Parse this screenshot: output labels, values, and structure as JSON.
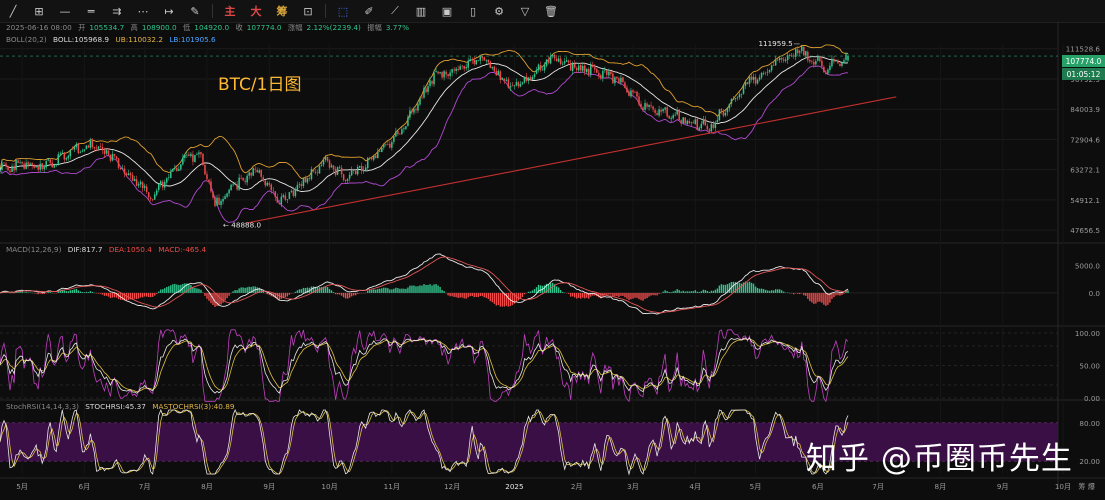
{
  "toolbar": {
    "icons": [
      "pencil-icon",
      "grid-icon",
      "horizontal-line-icon",
      "double-line-icon",
      "channel-icon",
      "dots-icon"
    ],
    "chinese_buttons": [
      "主",
      "大",
      "筹"
    ],
    "icons_right": [
      "select-icon",
      "pen-icon",
      "ruler-icon",
      "bars-icon",
      "image-icon",
      "page-icon",
      "settings-icon",
      "filter-icon",
      "trash-icon"
    ]
  },
  "info": {
    "date": "2025-06-16 08:00",
    "open_label": "开",
    "open": "105534.7",
    "high_label": "高",
    "high": "108900.0",
    "low_label": "低",
    "low": "104920.0",
    "close_label": "收",
    "close": "107774.0",
    "change_label": "涨幅",
    "change": "2.12%(2239.4)",
    "amp_label": "振幅",
    "amp": "3.77%"
  },
  "boll": {
    "label": "BOLL(20,2)",
    "boll": "BOLL:105968.9",
    "ub": "UB:110032.2",
    "lb": "LB:101905.6"
  },
  "title": "BTC/1日图",
  "price_axis": [
    "111528.6",
    "96792.9",
    "84003.9",
    "72904.6",
    "63272.1",
    "54912.1",
    "47656.5"
  ],
  "current_price": "107774.0",
  "countdown": "01:05:12",
  "peak_label": "111959.5",
  "low_label": "48888.0",
  "macd": {
    "label": "MACD(12,26,9)",
    "dif": "DIF:817.7",
    "dea": "DEA:1050.4",
    "macd": "MACD:-465.4",
    "axis": [
      "5000.0",
      "0.0"
    ]
  },
  "kdj": {
    "axis": [
      "100.00",
      "50.00",
      "0.00"
    ]
  },
  "stochrsi": {
    "label": "StochRSI(14,14,3,3)",
    "value": "STOCHRSI:45.37",
    "ma": "MASTOCHRSI(3):40.89",
    "axis": [
      "80.00",
      "20.00"
    ]
  },
  "time_axis": [
    "5月",
    "6月",
    "7月",
    "8月",
    "9月",
    "10月",
    "11月",
    "12月",
    "2025",
    "2月",
    "3月",
    "4月",
    "5月",
    "6月",
    "7月",
    "8月",
    "9月",
    "10月"
  ],
  "time_axis_right": "筹 爆",
  "watermark": "知乎 @币圈币先生",
  "colors": {
    "up": "#31c48d",
    "down": "#ef4a4a",
    "boll_mid": "#e8e8e8",
    "boll_ub": "#e0a030",
    "boll_lb": "#b04ad0",
    "trend": "#c43030"
  },
  "chart_data": {
    "type": "candlestick",
    "title": "BTC/1日图",
    "period": "daily",
    "x_range": [
      "2024-04-20",
      "2025-06-16"
    ],
    "price_ylim": [
      45500,
      113500
    ],
    "anchors": [
      {
        "date": "2024-04-20",
        "price": 64000
      },
      {
        "date": "2024-05-15",
        "price": 65000
      },
      {
        "date": "2024-05-25",
        "price": 69000
      },
      {
        "date": "2024-06-07",
        "price": 71500
      },
      {
        "date": "2024-06-25",
        "price": 61000
      },
      {
        "date": "2024-07-05",
        "price": 56000
      },
      {
        "date": "2024-07-20",
        "price": 67000
      },
      {
        "date": "2024-07-28",
        "price": 68000
      },
      {
        "date": "2024-08-05",
        "price": 54000
      },
      {
        "date": "2024-08-25",
        "price": 63500
      },
      {
        "date": "2024-09-06",
        "price": 54000
      },
      {
        "date": "2024-09-28",
        "price": 65500
      },
      {
        "date": "2024-10-10",
        "price": 60500
      },
      {
        "date": "2024-10-28",
        "price": 70000
      },
      {
        "date": "2024-11-06",
        "price": 76000
      },
      {
        "date": "2024-11-22",
        "price": 98500
      },
      {
        "date": "2024-12-17",
        "price": 106500
      },
      {
        "date": "2024-12-30",
        "price": 92500
      },
      {
        "date": "2025-01-20",
        "price": 106000
      },
      {
        "date": "2025-02-20",
        "price": 97000
      },
      {
        "date": "2025-03-05",
        "price": 86000
      },
      {
        "date": "2025-04-08",
        "price": 77000
      },
      {
        "date": "2025-04-25",
        "price": 94000
      },
      {
        "date": "2025-05-10",
        "price": 103000
      },
      {
        "date": "2025-05-22",
        "price": 111000
      },
      {
        "date": "2025-06-05",
        "price": 101500
      },
      {
        "date": "2025-06-16",
        "price": 107774
      }
    ],
    "last_candle": {
      "date": "2025-06-16",
      "open": 105534.7,
      "high": 108900.0,
      "low": 104920.0,
      "close": 107774.0
    },
    "annotations": [
      {
        "text": "111959.5",
        "type": "high"
      },
      {
        "text": "48888.0",
        "type": "low"
      }
    ],
    "indicators": {
      "boll": {
        "period": 20,
        "k": 2,
        "mid": 105968.9,
        "ub": 110032.2,
        "lb": 101905.6
      },
      "macd": {
        "dif": 817.7,
        "dea": 1050.4,
        "macd": -465.4
      },
      "stochrsi": {
        "k": 45.37,
        "d": 40.89
      }
    },
    "trendline": [
      {
        "date": "2024-08-20",
        "price": 49200
      },
      {
        "date": "2025-07-10",
        "price": 89000
      }
    ]
  }
}
